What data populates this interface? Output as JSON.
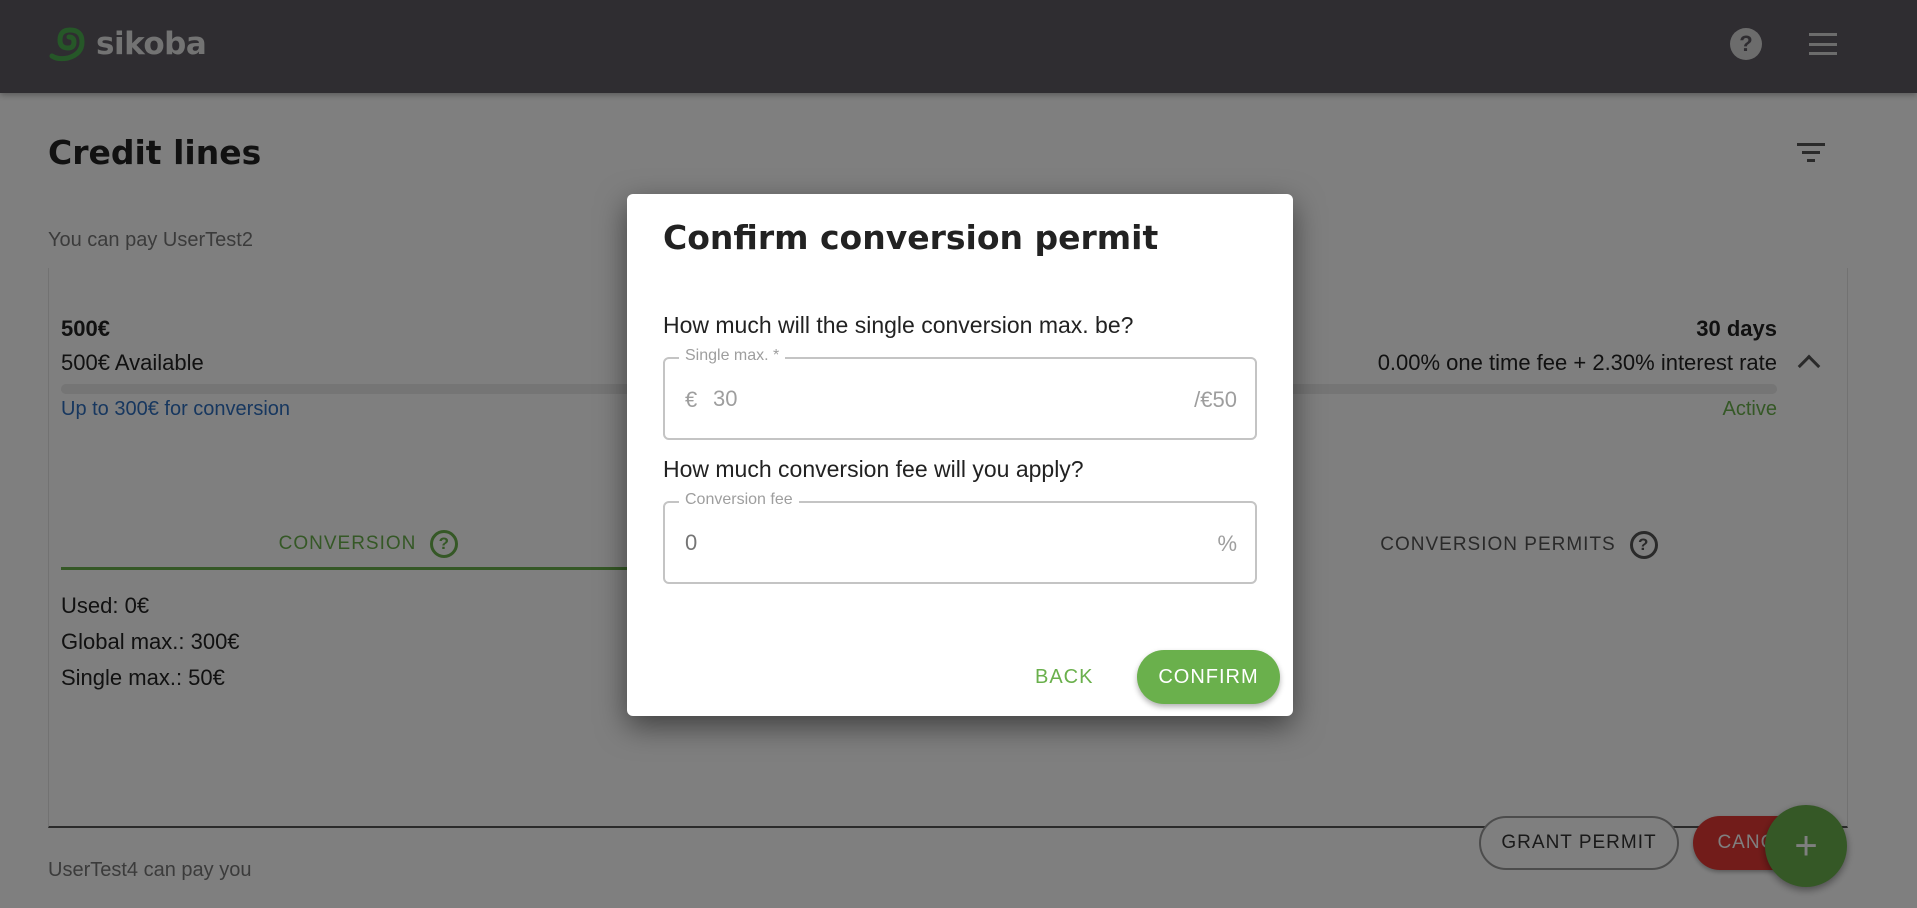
{
  "header": {
    "logo_text": "sikoba",
    "help_icon": "help-circle-icon",
    "menu_icon": "hamburger-menu-icon"
  },
  "page": {
    "title": "Credit lines",
    "filter_icon": "filter-icon",
    "section_outgoing": "You can pay UserTest2",
    "section_incoming": "UserTest4 can pay you"
  },
  "credit_line": {
    "amount": "500€",
    "available": "500€ Available",
    "available_fraction": 1.0,
    "conversion_note": "Up to 300€ for conversion",
    "term": "30 days",
    "fees": "0.00% one time fee + 2.30% interest rate",
    "status": "Active",
    "colors": {
      "status": "#6ab04c",
      "link": "#2e6fbf"
    },
    "tabs": [
      {
        "label": "CONVERSION",
        "active": true
      },
      {
        "label": "CONVERSION PERMITS",
        "active": false
      }
    ],
    "stats": {
      "used": "Used: 0€",
      "global_max": "Global max.: 300€",
      "single_max": "Single max.: 50€"
    },
    "buttons": {
      "grant": "GRANT PERMIT",
      "cancel": "CANCEL"
    }
  },
  "fab": {
    "label": "+"
  },
  "dialog": {
    "title": "Confirm conversion permit",
    "q1": "How much will the single conversion max. be?",
    "single_max": {
      "label": "Single max. *",
      "prefix": "€",
      "value": "30",
      "suffix": "/€50"
    },
    "q2": "How much conversion fee will you apply?",
    "conversion_fee": {
      "label": "Conversion fee",
      "placeholder": "0",
      "value": "",
      "suffix": "%"
    },
    "back_label": "BACK",
    "confirm_label": "CONFIRM",
    "accent_color": "#6ab04c"
  }
}
